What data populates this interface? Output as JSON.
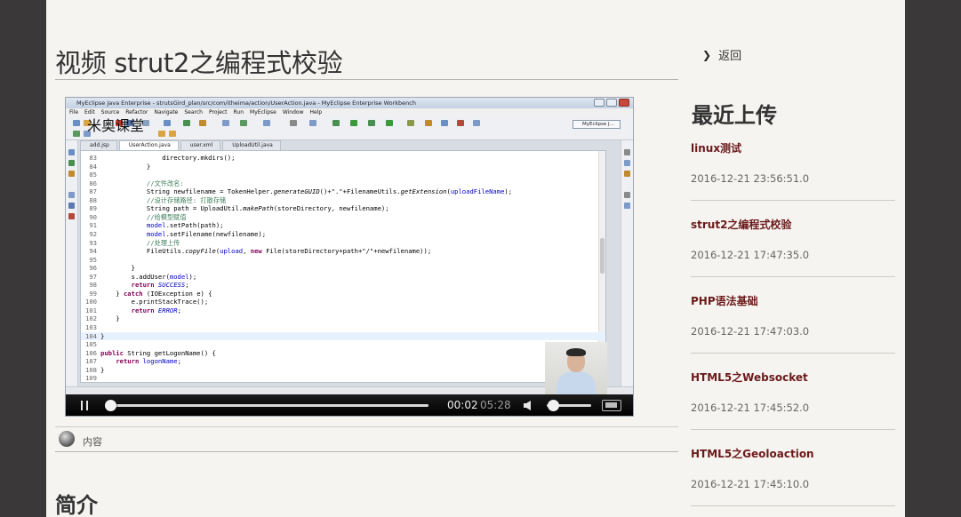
{
  "page": {
    "title": "视频 strut2之编程式校验",
    "content_tab_label": "内容",
    "intro_heading": "简介"
  },
  "video": {
    "window_title": "MyEclipse Java Enterprise - strutsGird_plan/src/com/itheima/action/UserAction.java - MyEclipse Enterprise Workbench",
    "menu": [
      "File",
      "Edit",
      "Source",
      "Refactor",
      "Navigate",
      "Search",
      "Project",
      "Run",
      "MyEclipse",
      "Window",
      "Help"
    ],
    "perspective": "MyEclipse J...",
    "watermark": "米奥课堂",
    "tabs": [
      "add.jsp",
      "UserAction.java",
      "user.xml",
      "UploadUtil.java"
    ],
    "code": [
      {
        "n": "83",
        "t": "                directory.mkdirs();"
      },
      {
        "n": "84",
        "t": "            }"
      },
      {
        "n": "85",
        "t": ""
      },
      {
        "n": "86",
        "t": "            //文件改名:"
      },
      {
        "n": "87",
        "t": "            String newfilename = TokenHelper.generateGUID()+\".\"+FilenameUtils.getExtension(uploadFileName);"
      },
      {
        "n": "88",
        "t": "            //设计存储路径: 打散存储"
      },
      {
        "n": "89",
        "t": "            String path = UploadUtil.makePath(storeDirectory, newfilename);"
      },
      {
        "n": "90",
        "t": "            //给模型赋值"
      },
      {
        "n": "91",
        "t": "            model.setPath(path);"
      },
      {
        "n": "92",
        "t": "            model.setFilename(newfilename);"
      },
      {
        "n": "93",
        "t": "            //处理上传"
      },
      {
        "n": "94",
        "t": "            FileUtils.copyFile(upload, new File(storeDirectory+path+\"/\"+newfilename));"
      },
      {
        "n": "95",
        "t": ""
      },
      {
        "n": "96",
        "t": "        }"
      },
      {
        "n": "97",
        "t": "        s.addUser(model);"
      },
      {
        "n": "98",
        "t": "        return SUCCESS;"
      },
      {
        "n": "99",
        "t": "    } catch (IOException e) {"
      },
      {
        "n": "100",
        "t": "        e.printStackTrace();"
      },
      {
        "n": "101",
        "t": "        return ERROR;"
      },
      {
        "n": "102",
        "t": "    }"
      },
      {
        "n": "103",
        "t": ""
      },
      {
        "n": "104",
        "t": "}"
      },
      {
        "n": "105",
        "t": ""
      },
      {
        "n": "106",
        "t": "public String getLogonName() {"
      },
      {
        "n": "107",
        "t": "    return logonName;"
      },
      {
        "n": "108",
        "t": "}"
      },
      {
        "n": "109",
        "t": ""
      }
    ],
    "current_time": "00:02",
    "total_time": "05:28",
    "progress": 0.006,
    "volume": 0.1
  },
  "sidebar": {
    "back_label": "返回",
    "recent_title": "最近上传",
    "items": [
      {
        "name": "linux测试",
        "date": "2016-12-21 23:56:51.0"
      },
      {
        "name": "strut2之编程式校验",
        "date": "2016-12-21 17:47:35.0"
      },
      {
        "name": "PHP语法基础",
        "date": "2016-12-21 17:47:03.0"
      },
      {
        "name": "HTML5之Websocket",
        "date": "2016-12-21 17:45:52.0"
      },
      {
        "name": "HTML5之Geoloaction",
        "date": "2016-12-21 17:45:10.0"
      }
    ]
  },
  "colors": {
    "page_bg": "#f6f4f1",
    "outer_bg": "#3a3838",
    "link": "#6b1a1a"
  }
}
